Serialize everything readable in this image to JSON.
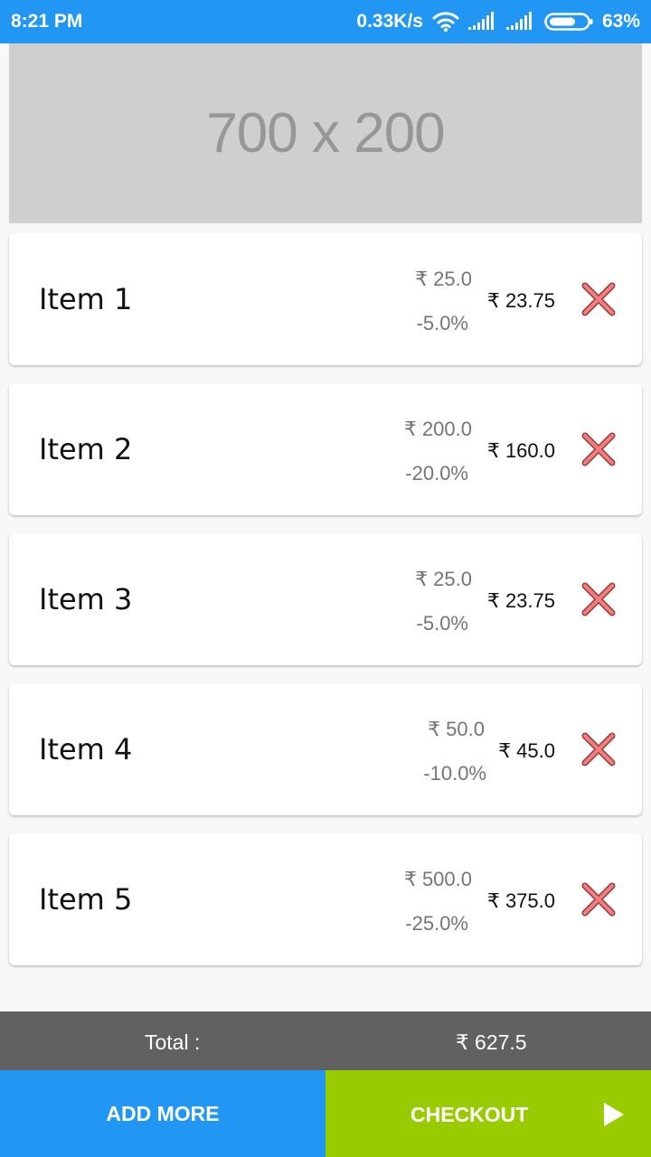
{
  "status_bar": {
    "time": "8:21 PM",
    "network_speed": "0.33K/s",
    "battery": "63%",
    "icons": [
      "wifi-icon",
      "signal-icon",
      "signal-icon",
      "battery-icon"
    ]
  },
  "banner": {
    "text": "700 x 200"
  },
  "items": [
    {
      "name": "Item 1",
      "original_price": "₹ 25.0",
      "discount": "-5.0%",
      "final_price": "₹ 23.75"
    },
    {
      "name": "Item 2",
      "original_price": "₹ 200.0",
      "discount": "-20.0%",
      "final_price": "₹ 160.0"
    },
    {
      "name": "Item 3",
      "original_price": "₹ 25.0",
      "discount": "-5.0%",
      "final_price": "₹ 23.75"
    },
    {
      "name": "Item 4",
      "original_price": "₹ 50.0",
      "discount": "-10.0%",
      "final_price": "₹ 45.0"
    },
    {
      "name": "Item 5",
      "original_price": "₹ 500.0",
      "discount": "-25.0%",
      "final_price": "₹ 375.0"
    }
  ],
  "remove_icon": "close-icon",
  "total": {
    "label": "Total :",
    "value": "₹ 627.5"
  },
  "actions": {
    "add_more_label": "ADD MORE",
    "checkout_label": "CHECKOUT",
    "checkout_icon": "play-icon"
  },
  "colors": {
    "primary": "#2196F3",
    "checkout": "#99CC00",
    "total_bar": "#616161",
    "remove_icon": "#F08080"
  }
}
